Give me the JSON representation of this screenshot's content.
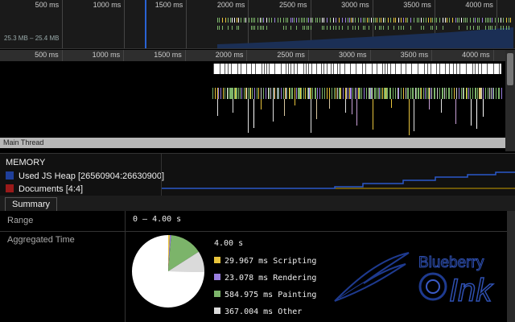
{
  "ruler_ticks": [
    "500 ms",
    "1000 ms",
    "1500 ms",
    "2000 ms",
    "2500 ms",
    "3000 ms",
    "3500 ms",
    "4000 ms"
  ],
  "overview": {
    "heap_range": "25.3 MB – 25.4 MB"
  },
  "main_thread_label": "Main Thread",
  "memory": {
    "title": "MEMORY",
    "legend": [
      {
        "label": "Used JS Heap [26560904:26630900]",
        "color": "#1f3f9a"
      },
      {
        "label": "Documents [4:4]",
        "color": "#9a1a1a"
      }
    ]
  },
  "tabs": {
    "summary": "Summary"
  },
  "summary": {
    "range_label": "Range",
    "range_value": "0 – 4.00 s",
    "agg_label": "Aggregated Time",
    "total": "4.00 s",
    "items": [
      {
        "label": "29.967 ms Scripting",
        "color": "#e8c43c",
        "value": 29.967
      },
      {
        "label": "23.078 ms Rendering",
        "color": "#9a7fe0",
        "value": 23.078
      },
      {
        "label": "584.975 ms Painting",
        "color": "#7cb46a",
        "value": 584.975
      },
      {
        "label": "367.004 ms Other",
        "color": "#dadada",
        "value": 367.004
      },
      {
        "label": "",
        "color": "#ffffff",
        "value": 2995
      }
    ]
  },
  "logo": {
    "text1": "Blueberry",
    "text2": "Ink"
  },
  "colors": {
    "selection": "#2a63d4",
    "heap_line": "#2b58c9",
    "doc_line": "#c9a000"
  }
}
